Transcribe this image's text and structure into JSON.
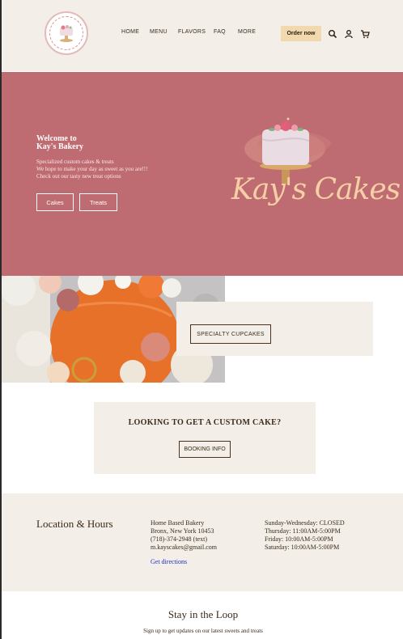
{
  "header": {
    "logo_text": "KAY'S CAKES",
    "nav": [
      "HOME",
      "MENU",
      "FLAVORS",
      "FAQ",
      "MORE"
    ],
    "order_label": "Order now",
    "icons": [
      "search-icon",
      "account-icon",
      "cart-icon"
    ]
  },
  "hero": {
    "title_line1": "Welcome to",
    "title_line2": "Kay's Bakery",
    "lines": [
      "Specialized custom cakes & treats",
      "We hope to make your day as sweet as you are!!!",
      "Check out our tasty new treat options"
    ],
    "buttons": [
      "Cakes",
      "Treats"
    ],
    "brand_script": "Kay's Cakes"
  },
  "cupcakes": {
    "button_label": "SPECIALTY CUPCAKES"
  },
  "custom": {
    "title": "LOOKING TO GET A CUSTOM CAKE?",
    "button_label": "BOOKING INFO"
  },
  "location": {
    "title": "Location & Hours",
    "address": [
      "Home Based Bakery",
      "Bronx, New York 10453",
      "(718)-374-2948 (text)",
      "m.kayscakes@gmail.com"
    ],
    "directions_label": "Get directions",
    "hours": [
      "Sunday-Wednesday: CLOSED",
      "Thursday: 11:00AM-5:00PM",
      "Friday: 10:00AM-5:00PM",
      "Saturday: 10:00AM-5:00PM"
    ]
  },
  "newsletter": {
    "title": "Stay in the Loop",
    "subtitle": "Sign up to get updates on our latest sweets and treats"
  },
  "colors": {
    "hero_bg": "#bf6b72",
    "cream_bg": "#f3efe8",
    "order_btn": "#f1d9ad",
    "script_gold": "#f5d0a6"
  }
}
